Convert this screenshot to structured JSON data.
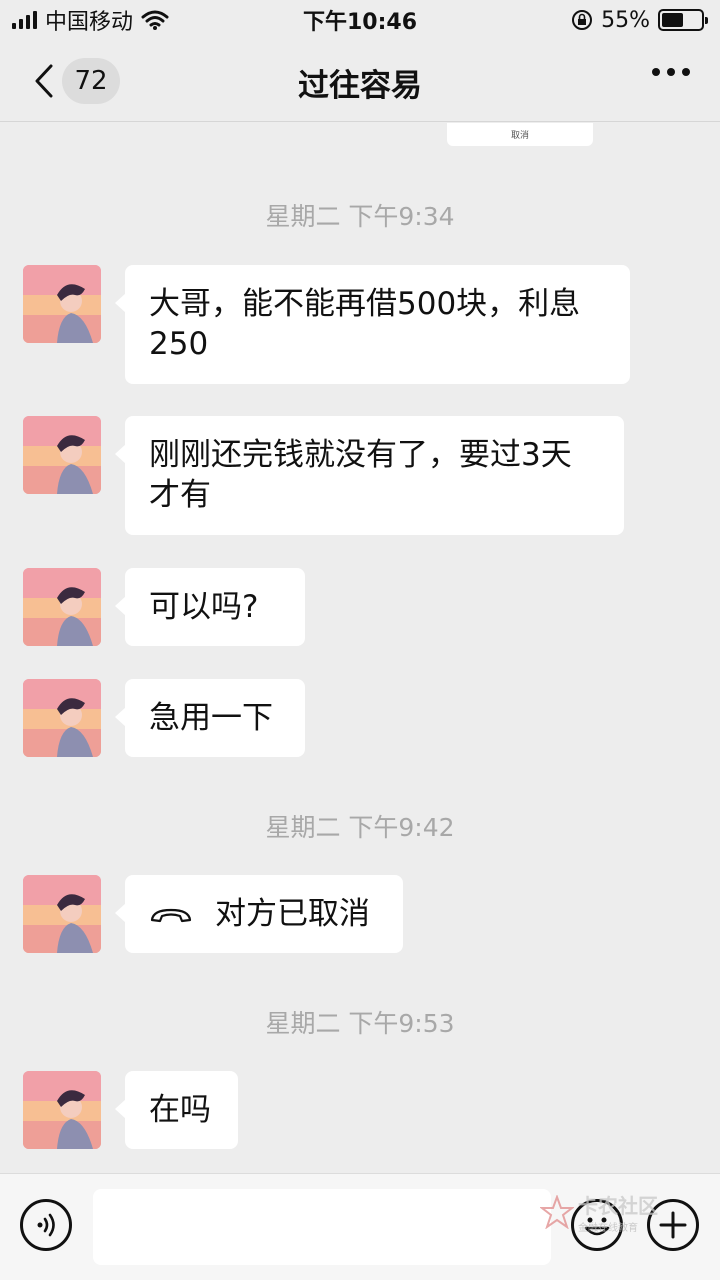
{
  "status_bar": {
    "carrier": "中国移动",
    "time": "下午10:46",
    "battery_percent": "55%",
    "battery_level": 0.55
  },
  "nav": {
    "unread_count": "72",
    "title": "过往容易"
  },
  "partial_card": {
    "label": "取消"
  },
  "messages": [
    {
      "timestamp": "星期二 下午9:34"
    },
    {
      "text": "大哥，能不能再借500块，利息250"
    },
    {
      "text": "刚刚还完钱就没有了，要过3天才有"
    },
    {
      "text": "可以吗?"
    },
    {
      "text": "急用一下"
    },
    {
      "timestamp": "星期二 下午9:42"
    },
    {
      "call_text": "对方已取消"
    },
    {
      "timestamp": "星期二 下午9:53"
    },
    {
      "text": "在吗"
    }
  ],
  "display": {
    "ts1": "星期二 下午9:34",
    "m1_line1": "大哥，能不能再借500块，利息",
    "m1_line2": "250",
    "m2_line1": "刚刚还完钱就没有了，要过3天",
    "m2_line2": "才有",
    "m3": "可以吗?",
    "m4": "急用一下",
    "ts2": "星期二 下午9:42",
    "m5": "对方已取消",
    "ts3": "星期二 下午9:53",
    "m6": "在吗"
  },
  "watermark": {
    "main": "卡农社区",
    "sub": "金融在线教育"
  },
  "icons": [
    "signal-icon",
    "wifi-icon",
    "lock-rotation-icon",
    "battery-icon",
    "back-icon",
    "more-icon",
    "phone-hangup-icon",
    "voice-icon",
    "emoji-icon",
    "plus-icon"
  ]
}
